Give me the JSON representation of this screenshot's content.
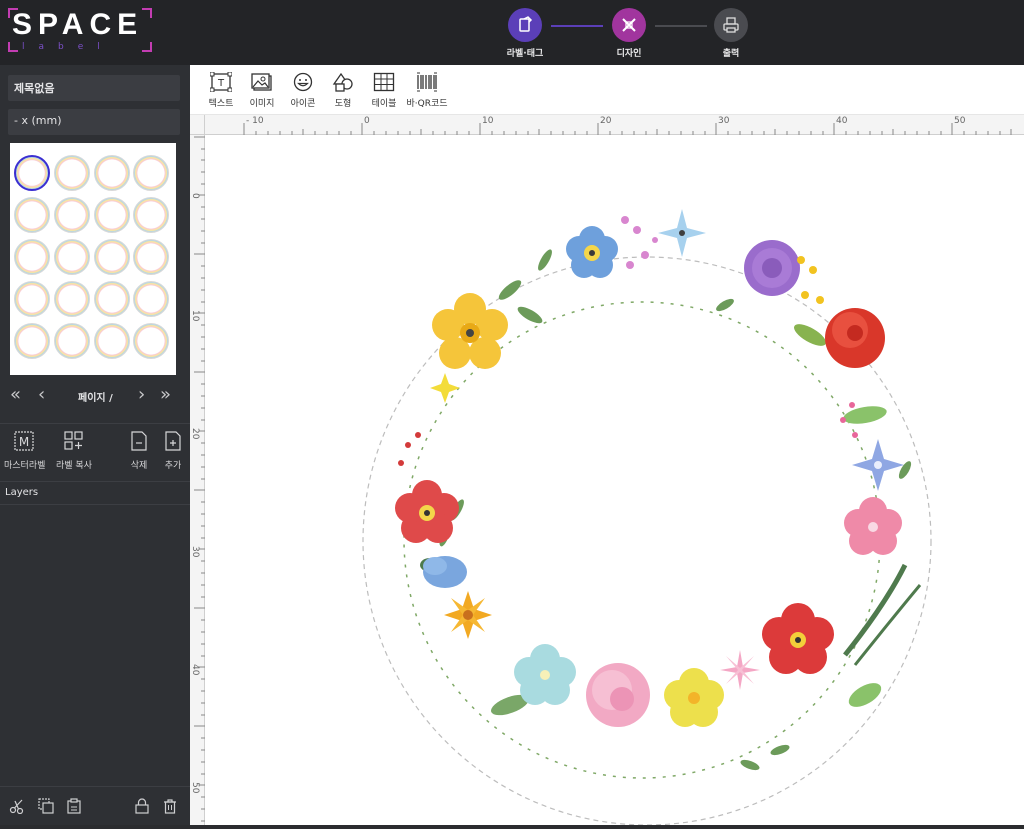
{
  "app": {
    "logo_text": "SPACE",
    "logo_sub": "label"
  },
  "steps": [
    {
      "label": "라벨·태그",
      "color": "#5b3fb8",
      "state": "done"
    },
    {
      "label": "디자인",
      "color": "#a1359e",
      "state": "active"
    },
    {
      "label": "출력",
      "color": "#4a4b50",
      "state": "pending"
    }
  ],
  "sidebar": {
    "title_value": "제목없음",
    "size_value": "- x (mm)",
    "pager_text": "페이지 /",
    "tools": [
      {
        "label": "마스터라벨",
        "icon": "master-label-icon"
      },
      {
        "label": "라벨 복사",
        "icon": "copy-label-icon"
      },
      {
        "label": "삭제",
        "icon": "delete-page-icon"
      },
      {
        "label": "추가",
        "icon": "add-page-icon"
      }
    ],
    "layers_title": "Layers",
    "bottom_icons": [
      "cut-icon",
      "duplicate-icon",
      "paste-icon",
      "lock-icon",
      "trash-icon"
    ]
  },
  "toolbar": {
    "items": [
      {
        "label": "텍스트",
        "icon": "text-icon"
      },
      {
        "label": "이미지",
        "icon": "image-icon"
      },
      {
        "label": "아이콘",
        "icon": "emoji-icon"
      },
      {
        "label": "도형",
        "icon": "shape-icon"
      },
      {
        "label": "테이블",
        "icon": "table-icon"
      },
      {
        "label": "바·QR코드",
        "icon": "barcode-icon"
      }
    ]
  },
  "rulers": {
    "h_labels": [
      "- 10",
      "0",
      "10",
      "20",
      "30",
      "40",
      "50"
    ],
    "v_labels": [
      "0",
      "10",
      "20",
      "30",
      "40",
      "50"
    ]
  },
  "colors": {
    "topbar": "#232427",
    "sidebar": "#2e3034",
    "accent_purple": "#5b3fb8",
    "accent_magenta": "#a1359e"
  }
}
